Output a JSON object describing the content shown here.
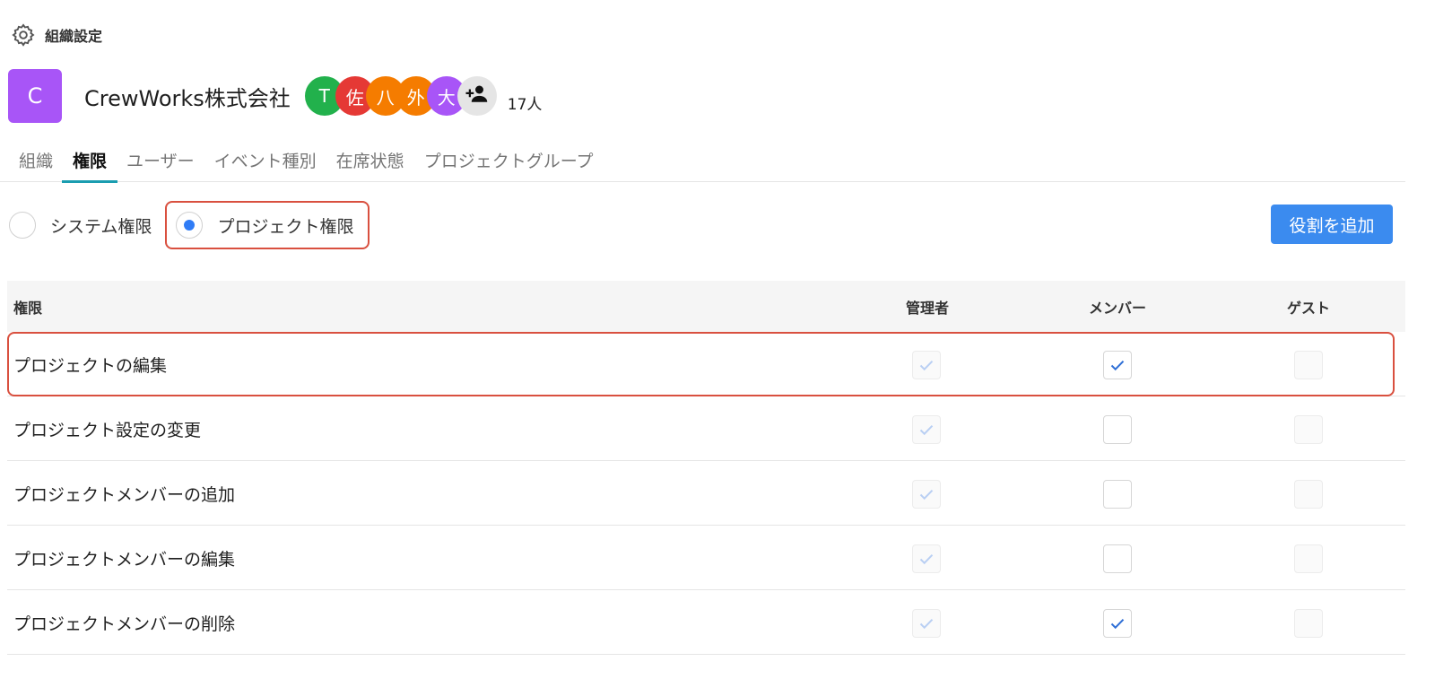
{
  "header": {
    "title": "組織設定"
  },
  "org": {
    "logo_letter": "C",
    "name": "CrewWorks株式会社",
    "avatars": [
      {
        "label": "T",
        "color": "#22b14c"
      },
      {
        "label": "佐",
        "color": "#e53935"
      },
      {
        "label": "八",
        "color": "#f57c00"
      },
      {
        "label": "外",
        "color": "#f57c00"
      },
      {
        "label": "大",
        "color": "#a855f7"
      }
    ],
    "member_count": "17人"
  },
  "tabs": [
    {
      "label": "組織",
      "active": false
    },
    {
      "label": "権限",
      "active": true
    },
    {
      "label": "ユーザー",
      "active": false
    },
    {
      "label": "イベント種別",
      "active": false
    },
    {
      "label": "在席状態",
      "active": false
    },
    {
      "label": "プロジェクトグループ",
      "active": false
    }
  ],
  "scope": {
    "options": [
      {
        "label": "システム権限",
        "selected": false
      },
      {
        "label": "プロジェクト権限",
        "selected": true
      }
    ]
  },
  "add_role_label": "役割を追加",
  "table": {
    "headers": {
      "permission": "権限",
      "admin": "管理者",
      "member": "メンバー",
      "guest": "ゲスト"
    },
    "rows": [
      {
        "name": "プロジェクトの編集",
        "admin": true,
        "member": true,
        "guest": false
      },
      {
        "name": "プロジェクト設定の変更",
        "admin": true,
        "member": false,
        "guest": false
      },
      {
        "name": "プロジェクトメンバーの追加",
        "admin": true,
        "member": false,
        "guest": false
      },
      {
        "name": "プロジェクトメンバーの編集",
        "admin": true,
        "member": false,
        "guest": false
      },
      {
        "name": "プロジェクトメンバーの削除",
        "admin": true,
        "member": true,
        "guest": false
      }
    ]
  },
  "colors": {
    "accent": "#3b8bef",
    "tab_underline": "#1a9db0",
    "highlight": "#d9503f",
    "check_active": "#2f6fd6",
    "check_disabled": "#b9cff3"
  }
}
